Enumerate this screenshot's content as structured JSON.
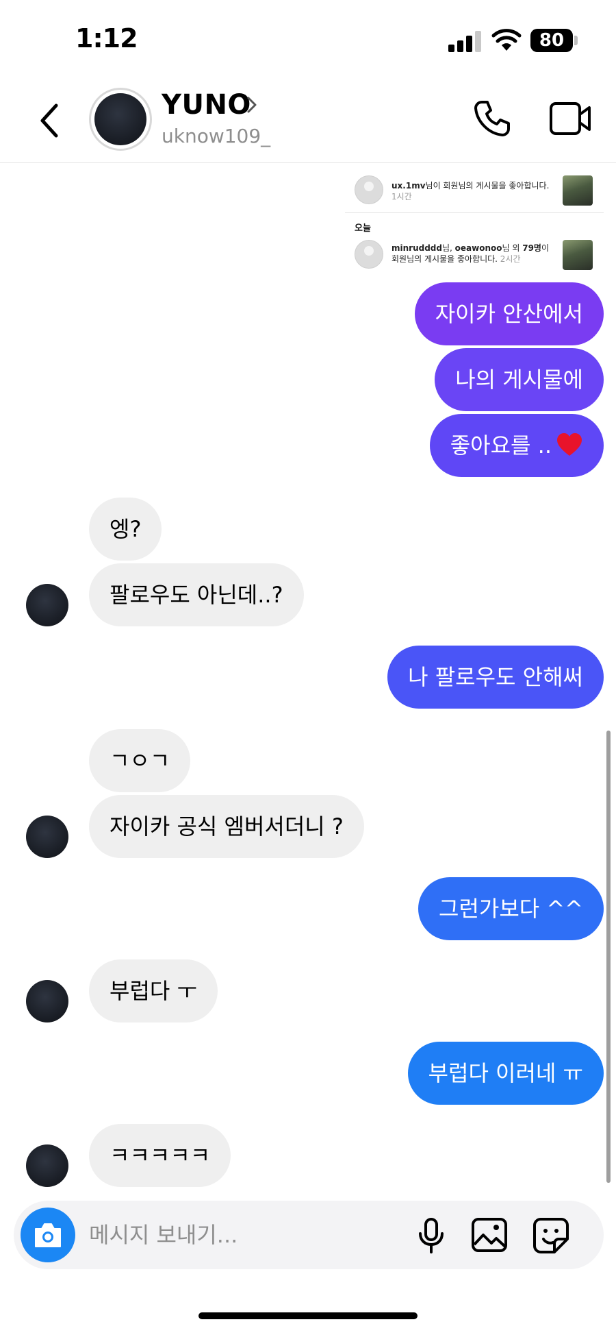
{
  "status_bar": {
    "time": "1:12",
    "battery": "80"
  },
  "header": {
    "name": "YUNO",
    "username": "uknow109_"
  },
  "shared_preview": {
    "row1": {
      "user": "ux.1mv",
      "text": "님이 회원님의 게시물을 좋아합니다.",
      "time": "1시간"
    },
    "section": "오늘",
    "row2": {
      "user_a": "minrudddd",
      "middle": "님, ",
      "user_b": "oeawonoo",
      "text_a": "님 외 ",
      "count": "79명",
      "text_b": "이 회원님의 게시물을 좋아합니다.",
      "time": "2시간"
    }
  },
  "messages": [
    {
      "text": "자이카 안산에서"
    },
    {
      "text": "나의 게시물에"
    },
    {
      "text": "좋아요를 .."
    },
    {
      "text": "엥?"
    },
    {
      "text": "팔로우도 아닌데..?"
    },
    {
      "text": "나 팔로우도 안해써"
    },
    {
      "text": "ㄱㅇㄱ"
    },
    {
      "text": "자이카 공식 엠버서더니 ?"
    },
    {
      "text": "그런가보다 ^^"
    },
    {
      "text": "부럽다 ㅜ"
    },
    {
      "text": "부럽다 이러네 ㅠ"
    },
    {
      "text": "ㅋㅋㅋㅋㅋ"
    }
  ],
  "composer": {
    "placeholder": "메시지 보내기..."
  },
  "colors": {
    "sent_1": "#7a3cf2",
    "sent_2": "#6a45f5",
    "sent_3": "#5f47f6",
    "sent_4": "#4a55f7",
    "sent_5": "#2f6ff6",
    "sent_6": "#1f7ef5",
    "received": "#efefef",
    "camera": "#1b87f4"
  }
}
